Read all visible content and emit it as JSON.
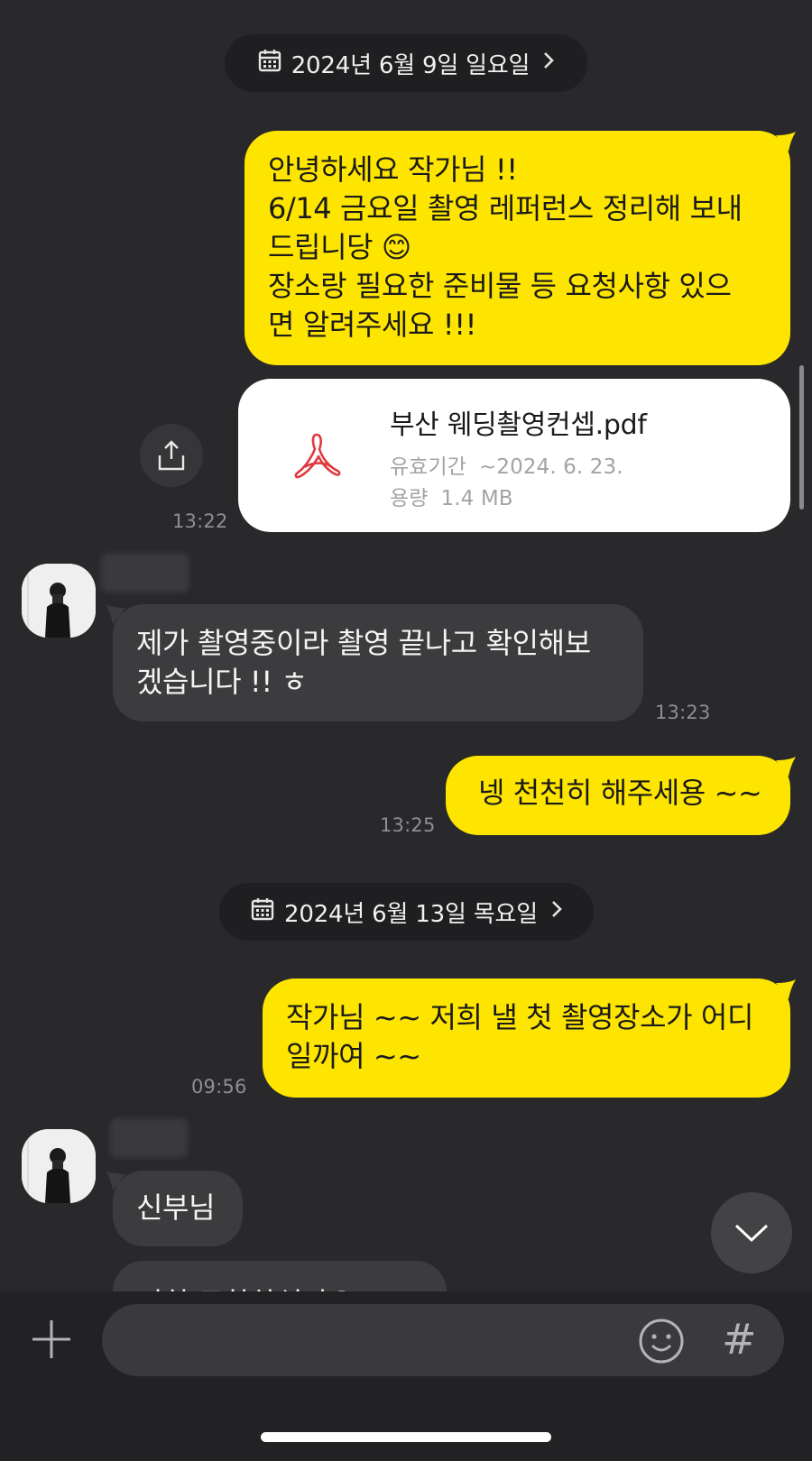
{
  "chat": {
    "date_1": "2024년 6월 9일 일요일",
    "date_2": "2024년 6월 13일 목요일",
    "messages": [
      {
        "lines": [
          "안녕하세요 작가님 !!",
          "6/14 금요일 촬영 레퍼런스 정리해 보내",
          "드립니당 😊",
          "장소랑 필요한 준비물 등 요청사항 있으",
          "면 알려주세요 !!!"
        ]
      },
      {
        "time": "13:22"
      },
      {
        "lines": [
          "제가 촬영중이라 촬영 끝나고 확인해보",
          "겠습니다 !! ㅎ"
        ],
        "time": "13:23"
      },
      {
        "text": "넹 천천히 해주세용 ~~",
        "time": "13:25"
      },
      {
        "lines": [
          "작가님 ~~ 저희 낼 첫 촬영장소가 어디",
          "일까여 ~~"
        ],
        "time": "09:56"
      },
      {
        "text": "신부님"
      },
      {
        "text": "저희 도착하셨나요 ?"
      }
    ],
    "file": {
      "name": "부산 웨딩촬영컨셉.pdf",
      "expiry_label": "유효기간",
      "expiry_value": "~2024. 6. 23.",
      "size_label": "용량",
      "size_value": "1.4 MB"
    }
  },
  "input": {
    "placeholder": "",
    "hash_symbol": "#"
  },
  "colors": {
    "background": "#29292b",
    "my_bubble": "#fee500",
    "their_bubble": "#3c3c3f",
    "pdf_icon": "#e0393e"
  },
  "icons": [
    "calendar-icon",
    "chevron-right-icon",
    "share-icon",
    "pdf-icon",
    "chevron-down-icon",
    "plus-icon",
    "emoji-icon",
    "hash-icon"
  ]
}
